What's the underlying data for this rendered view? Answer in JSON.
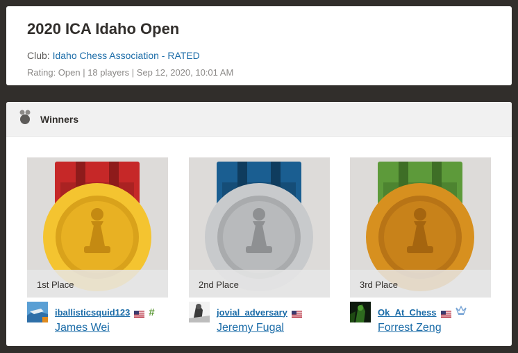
{
  "tournament": {
    "title": "2020 ICA Idaho Open",
    "club_prefix": "Club: ",
    "club_name": "Idaho Chess Association - RATED",
    "rating_line": "Rating: Open | 18 players | Sep 12, 2020, 10:01 AM"
  },
  "winners": {
    "heading": "Winners",
    "icon": "medal-icon",
    "places": [
      {
        "place_label": "1st Place",
        "medal": "gold",
        "ribbon_color": "#c62828",
        "medal_color": "#f4c430",
        "username": "iballisticsquid123",
        "country_flag": "us-flag-icon",
        "badge": "#",
        "badge_icon": "hash-icon",
        "badge_color": "#5f9a3a",
        "real_name": "James Wei"
      },
      {
        "place_label": "2nd Place",
        "medal": "silver",
        "ribbon_color": "#1a5e91",
        "medal_color": "#c8cacc",
        "username": "jovial_adversary",
        "country_flag": "us-flag-icon",
        "real_name": "Jeremy Fugal"
      },
      {
        "place_label": "3rd Place",
        "medal": "bronze",
        "ribbon_color": "#5d9a3a",
        "medal_color": "#d7901f",
        "username": "Ok_At_Chess",
        "country_flag": "us-flag-icon",
        "badge_icon": "crown-icon",
        "badge_color": "#7aa6d6",
        "real_name": "Forrest Zeng"
      }
    ]
  }
}
